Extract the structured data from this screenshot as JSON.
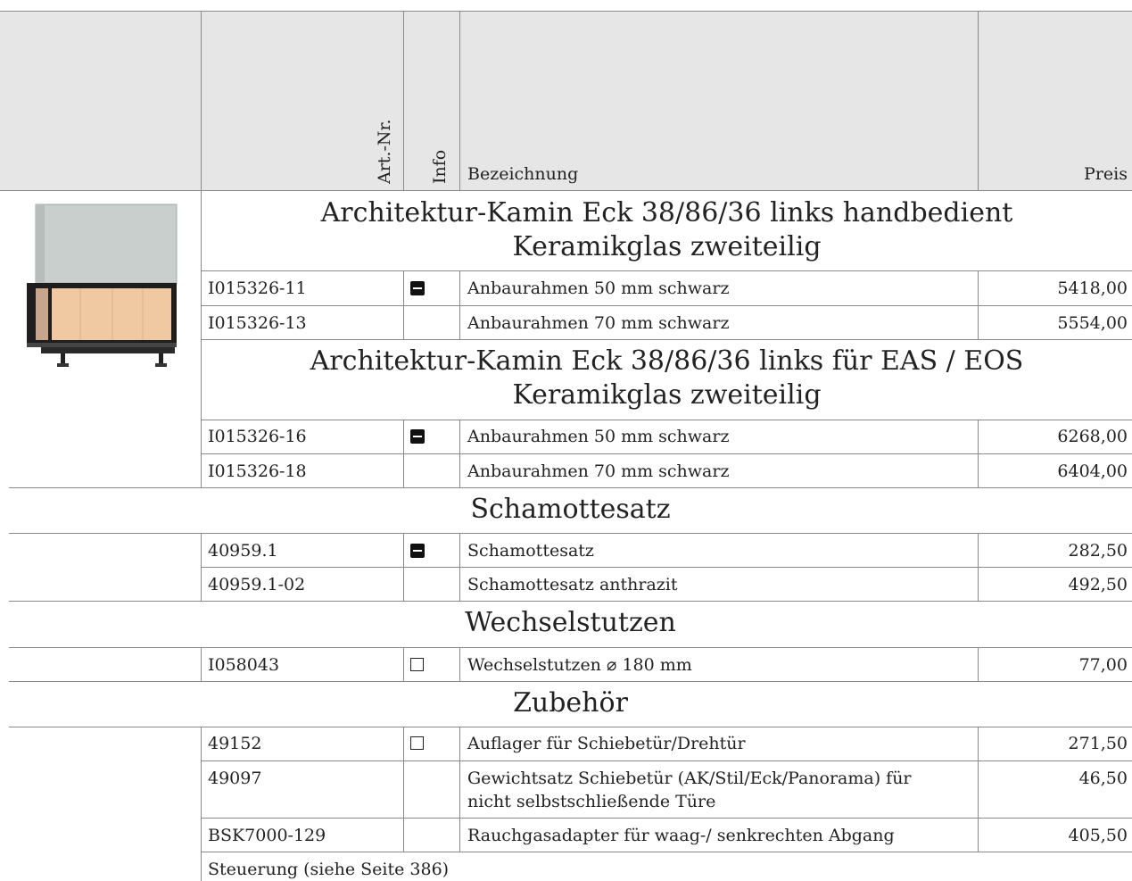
{
  "header": {
    "art_nr": "Art.-Nr.",
    "info": "Info",
    "bezeichnung": "Bezeichnung",
    "preis": "Preis"
  },
  "sections": {
    "s1_line1": "Architektur-Kamin Eck 38/86/36 links handbedient",
    "s1_line2": "Keramikglas zweiteilig",
    "s2_line1": "Architektur-Kamin Eck 38/86/36 links für EAS / EOS",
    "s2_line2": "Keramikglas zweiteilig",
    "s3": "Schamottesatz",
    "s4": "Wechselstutzen",
    "s5": "Zubehör"
  },
  "rows": [
    {
      "art": "I015326-11",
      "desc": "Anbaurahmen 50 mm schwarz",
      "price": "5418,00",
      "info_icon": "minus-box"
    },
    {
      "art": "I015326-13",
      "desc": "Anbaurahmen 70 mm schwarz",
      "price": "5554,00"
    },
    {
      "art": "I015326-16",
      "desc": "Anbaurahmen 50 mm schwarz",
      "price": "6268,00",
      "info_icon": "minus-box"
    },
    {
      "art": "I015326-18",
      "desc": "Anbaurahmen 70 mm schwarz",
      "price": "6404,00"
    },
    {
      "art": "40959.1",
      "desc": "Schamottesatz",
      "price": "282,50",
      "info_icon": "minus-box"
    },
    {
      "art": "40959.1-02",
      "desc": "Schamottesatz anthrazit",
      "price": "492,50"
    },
    {
      "art": "I058043",
      "desc": "Wechselstutzen ⌀ 180 mm",
      "price": "77,00",
      "info_icon": "empty-box"
    },
    {
      "art": "49152",
      "desc": "Auflager für Schiebetür/Drehtür",
      "price": "271,50",
      "info_icon": "empty-box"
    },
    {
      "art": "49097",
      "desc_line1": "Gewichtsatz Schiebetür (AK/Stil/Eck/Panorama) für",
      "desc_line2": "nicht selbstschließende Türe",
      "price": "46,50"
    },
    {
      "art": "BSK7000-129",
      "desc": "Rauchgasadapter für waag-/ senkrechten Abgang",
      "price": "405,50"
    }
  ],
  "footer_note": "Steuerung (siehe Seite 386)",
  "product_image": "fireplace-product-image",
  "colors": {
    "header_bg": "#e6e6e6",
    "grid_line": "#8a8a8a"
  }
}
